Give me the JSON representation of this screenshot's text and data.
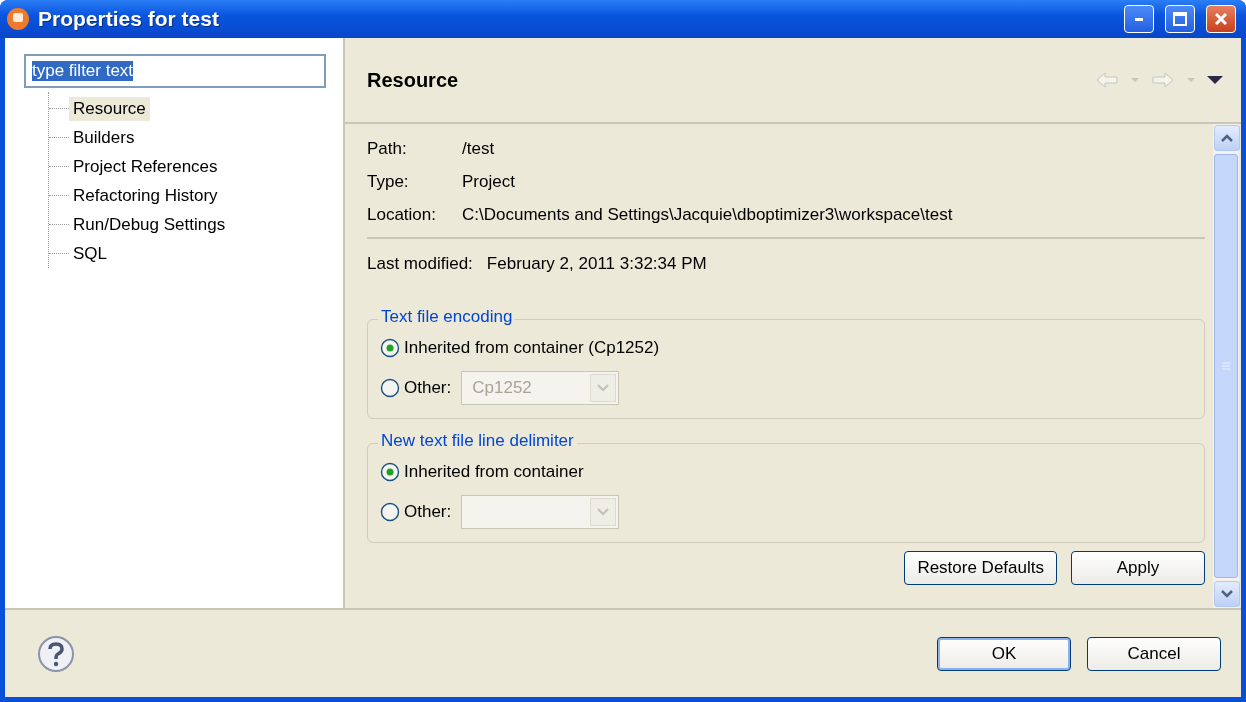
{
  "window": {
    "title": "Properties for test"
  },
  "filter": {
    "value": "type filter text"
  },
  "tree": [
    {
      "label": "Resource",
      "selected": true
    },
    {
      "label": "Builders",
      "selected": false
    },
    {
      "label": "Project References",
      "selected": false
    },
    {
      "label": "Refactoring History",
      "selected": false
    },
    {
      "label": "Run/Debug Settings",
      "selected": false
    },
    {
      "label": "SQL",
      "selected": false
    }
  ],
  "page": {
    "title": "Resource",
    "info": [
      {
        "label": "Path:",
        "value": "/test"
      },
      {
        "label": "Type:",
        "value": "Project"
      },
      {
        "label": "Location:",
        "value": "C:\\Documents and Settings\\Jacquie\\dboptimizer3\\workspace\\test"
      }
    ],
    "last_modified": {
      "label": "Last modified:",
      "value": "February 2, 2011 3:32:34 PM"
    },
    "groups": [
      {
        "title": "Text file encoding",
        "options": [
          {
            "kind": "plain",
            "label": "Inherited from container (Cp1252)",
            "checked": true
          },
          {
            "kind": "combo",
            "label": "Other:",
            "checked": false,
            "combo": {
              "value": "Cp1252",
              "disabled": true
            }
          }
        ]
      },
      {
        "title": "New text file line delimiter",
        "options": [
          {
            "kind": "plain",
            "label": "Inherited from container",
            "checked": true
          },
          {
            "kind": "combo",
            "label": "Other:",
            "checked": false,
            "combo": {
              "disabled": true
            }
          }
        ]
      }
    ],
    "page_buttons": [
      "Restore Defaults",
      "Apply"
    ]
  },
  "buttons": [
    {
      "label": "OK",
      "default": true
    },
    {
      "label": "Cancel",
      "default": false
    }
  ]
}
